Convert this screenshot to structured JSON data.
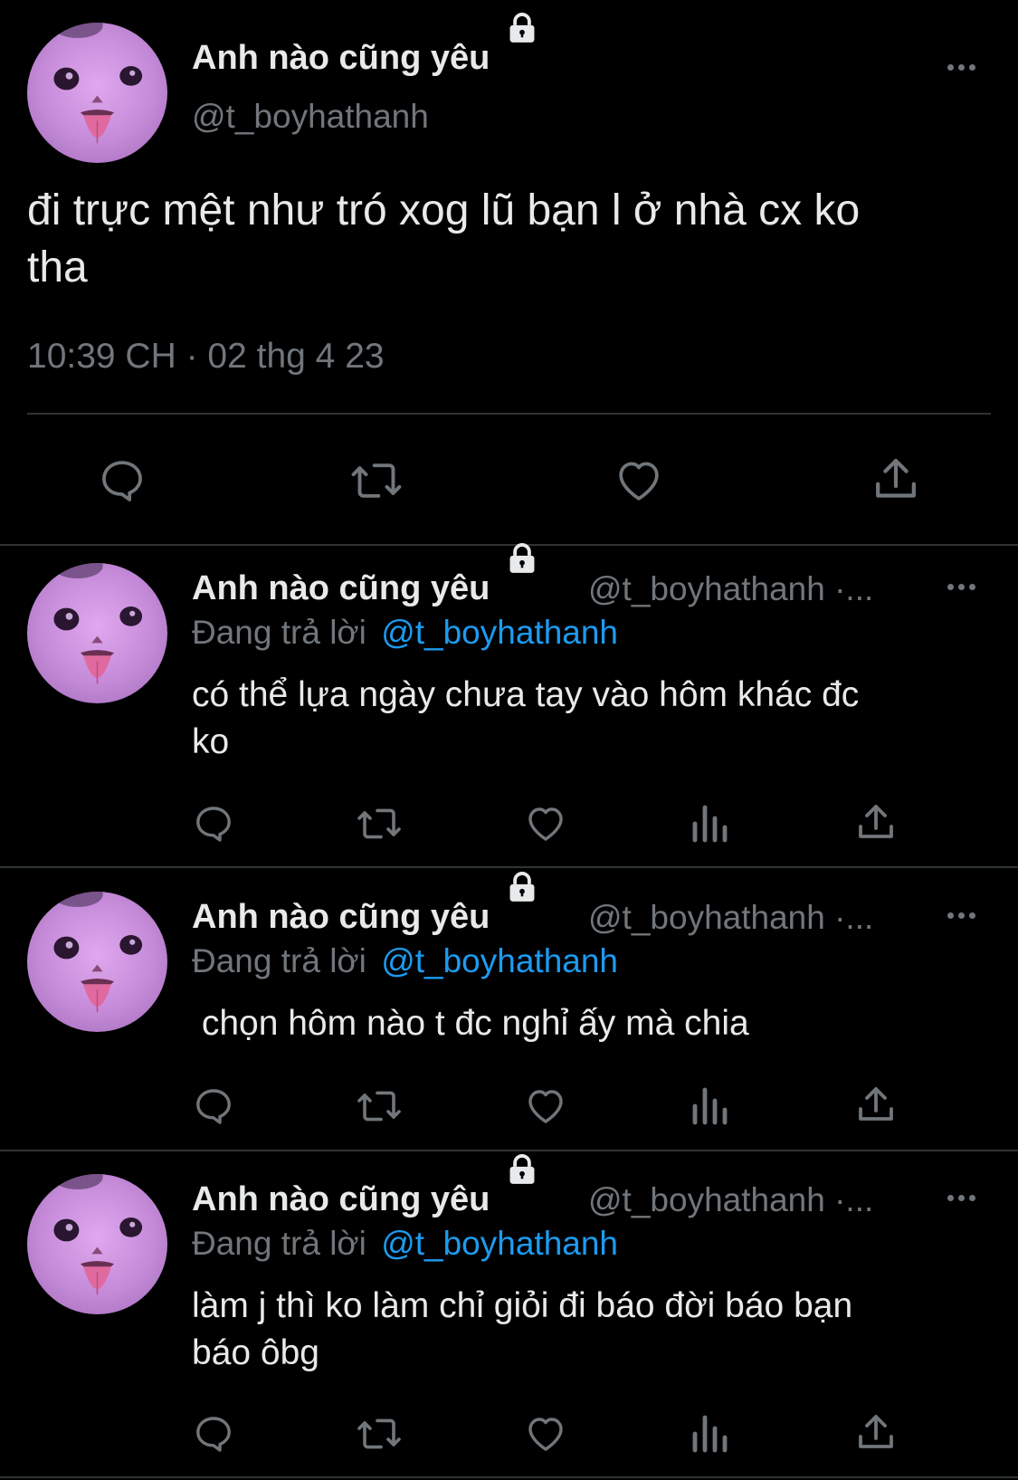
{
  "main_tweet": {
    "display_name": "Anh nào cũng yêu",
    "handle": "@t_boyhathanh",
    "text_line1": "đi trực mệt như tró xog lũ bạn l ở nhà cx ko",
    "text_line2": "tha",
    "timestamp": "10:39 CH · 02 thg 4 23"
  },
  "replies": [
    {
      "display_name": "Anh nào cũng yêu",
      "handle_trunc": "@t_boyhathanh ·...",
      "replying_prefix": "Đang trả lời",
      "replying_to": "@t_boyhathanh",
      "text_line1": "có thể lựa ngày chưa tay vào hôm khác đc",
      "text_line2": "ko"
    },
    {
      "display_name": "Anh nào cũng yêu",
      "handle_trunc": "@t_boyhathanh ·...",
      "replying_prefix": "Đang trả lời",
      "replying_to": "@t_boyhathanh",
      "text_line1": " chọn hôm nào t đc nghỉ ấy mà chia",
      "text_line2": ""
    },
    {
      "display_name": "Anh nào cũng yêu",
      "handle_trunc": "@t_boyhathanh ·...",
      "replying_prefix": "Đang trả lời",
      "replying_to": "@t_boyhathanh",
      "text_line1": "làm j thì ko làm chỉ giỏi đi báo đời báo bạn",
      "text_line2": "báo ôbg"
    }
  ],
  "icons": {
    "reply": "reply-icon",
    "retweet": "retweet-icon",
    "like": "heart-icon",
    "views": "views-icon",
    "share": "share-icon",
    "more": "more-icon",
    "lock": "lock-icon"
  },
  "colors": {
    "background": "#000000",
    "text": "#e7e9ea",
    "muted": "#71767b",
    "link": "#1d9bf0",
    "divider": "#2f3336",
    "avatar": "#c48ad8"
  }
}
